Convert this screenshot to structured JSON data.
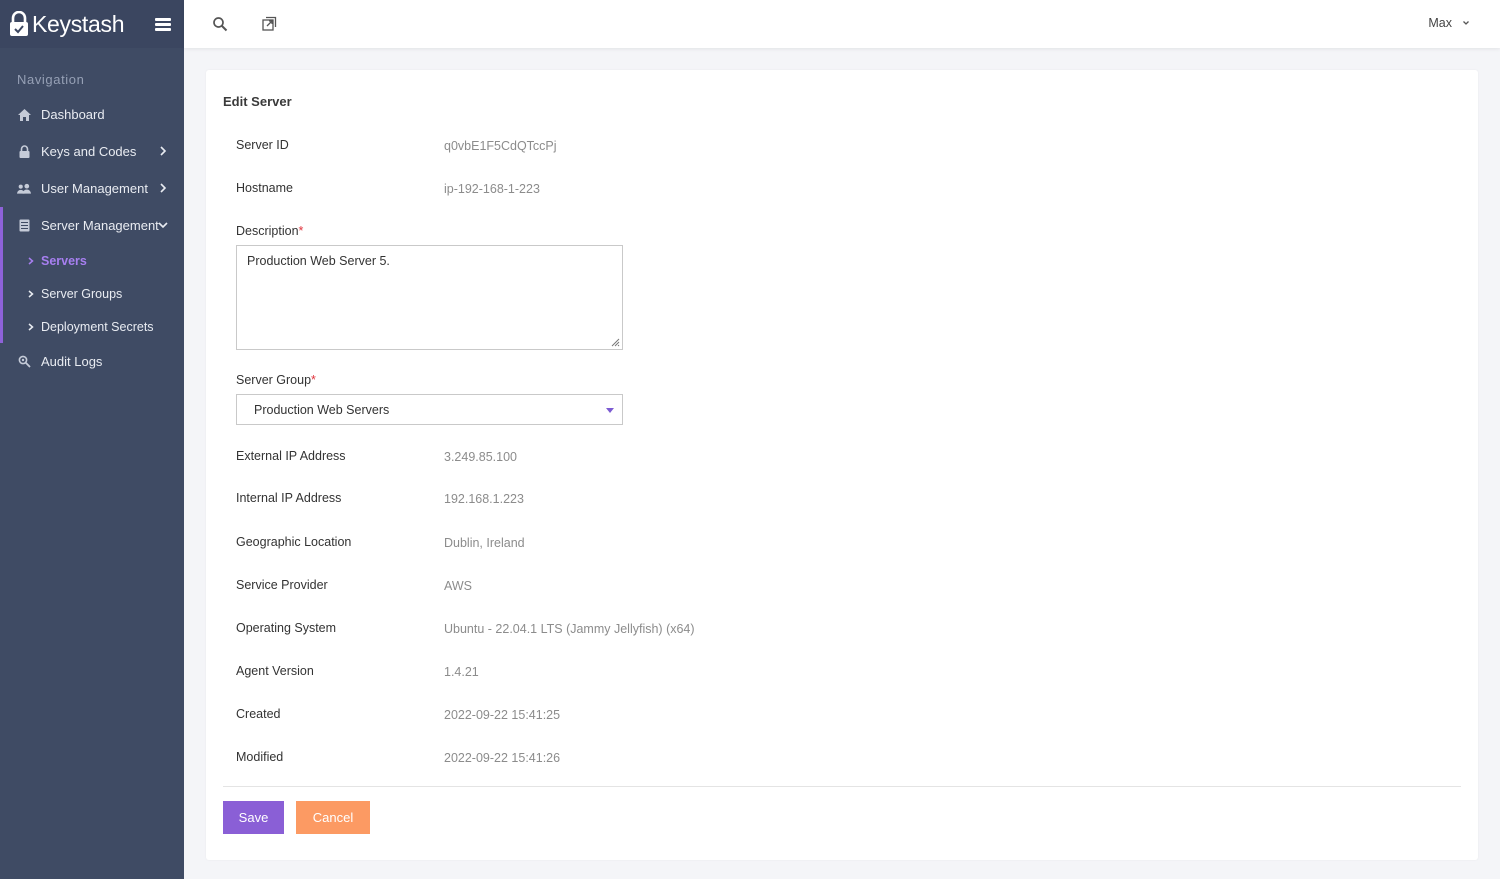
{
  "brand": {
    "name": "Keystash"
  },
  "sidebar": {
    "heading": "Navigation",
    "items": [
      {
        "label": "Dashboard",
        "icon": "home-icon"
      },
      {
        "label": "Keys and Codes",
        "icon": "lock-icon"
      },
      {
        "label": "User Management",
        "icon": "users-icon"
      },
      {
        "label": "Server Management",
        "icon": "server-icon"
      },
      {
        "label": "Audit Logs",
        "icon": "search-zoom-icon"
      }
    ],
    "subitems": [
      {
        "label": "Servers",
        "selected": true
      },
      {
        "label": "Server Groups"
      },
      {
        "label": "Deployment Secrets"
      }
    ]
  },
  "topbar": {
    "user": "Max"
  },
  "form": {
    "title": "Edit Server",
    "server_id": {
      "label": "Server ID",
      "value": "q0vbE1F5CdQTccPj"
    },
    "hostname": {
      "label": "Hostname",
      "value": "ip-192-168-1-223"
    },
    "description": {
      "label": "Description",
      "value": "Production Web Server 5."
    },
    "server_group": {
      "label": "Server Group",
      "value": "Production Web Servers"
    },
    "external_ip": {
      "label": "External IP Address",
      "value": "3.249.85.100"
    },
    "internal_ip": {
      "label": "Internal IP Address",
      "value": "192.168.1.223"
    },
    "location": {
      "label": "Geographic Location",
      "value": "Dublin, Ireland"
    },
    "provider": {
      "label": "Service Provider",
      "value": "AWS"
    },
    "os": {
      "label": "Operating System",
      "value": "Ubuntu - 22.04.1 LTS (Jammy Jellyfish) (x64)"
    },
    "agent": {
      "label": "Agent Version",
      "value": "1.4.21"
    },
    "created": {
      "label": "Created",
      "value": "2022-09-22 15:41:25"
    },
    "modified": {
      "label": "Modified",
      "value": "2022-09-22 15:41:26"
    },
    "required_mark": "*",
    "save_label": "Save",
    "cancel_label": "Cancel"
  },
  "colors": {
    "sidebar": "#3f4b64",
    "accent": "#8a5fd6",
    "cancel": "#fc9a63",
    "required": "#e0343d"
  }
}
